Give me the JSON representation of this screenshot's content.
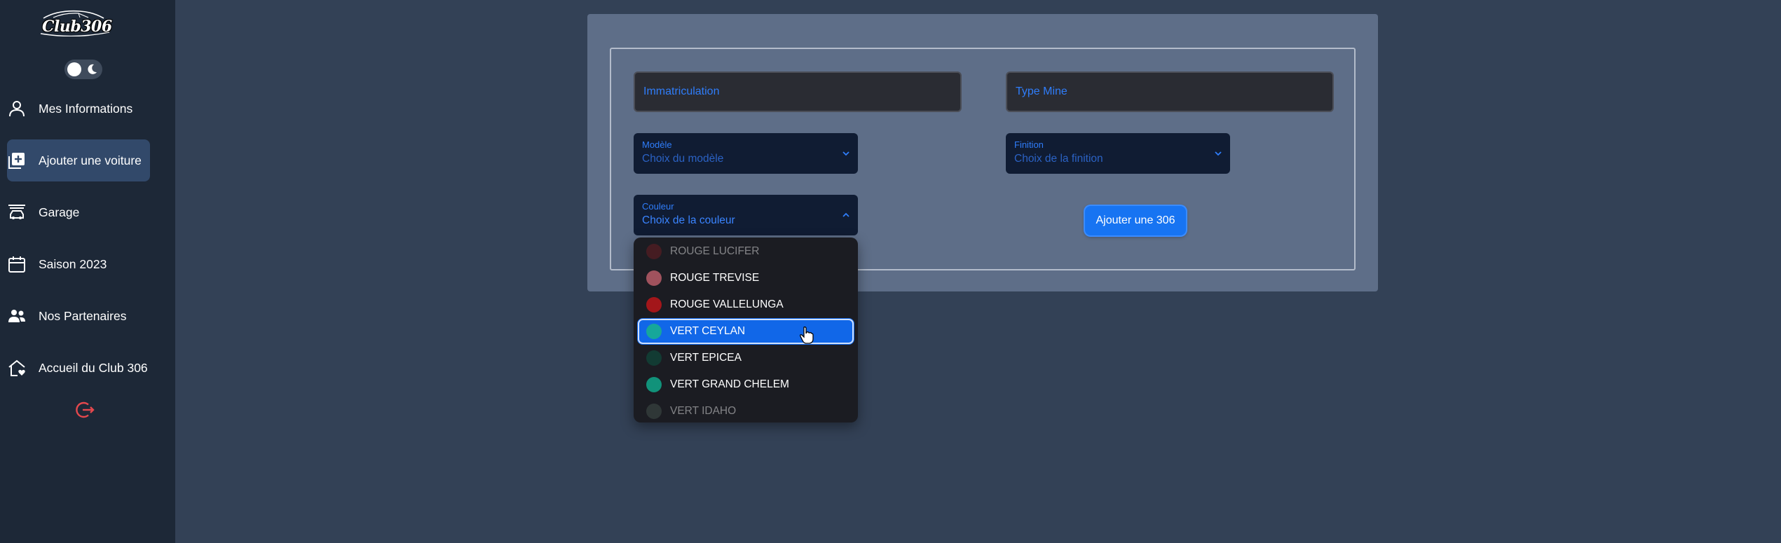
{
  "sidebar": {
    "logo_text": "Club306",
    "items": [
      {
        "label": "Mes Informations",
        "icon": "user-icon"
      },
      {
        "label": "Ajouter une voiture",
        "icon": "add-box-icon",
        "active": true
      },
      {
        "label": "Garage",
        "icon": "car-garage-icon"
      },
      {
        "label": "Saison 2023",
        "icon": "calendar-icon"
      },
      {
        "label": "Nos Partenaires",
        "icon": "people-icon"
      },
      {
        "label": "Accueil du Club 306",
        "icon": "home-heart-icon"
      }
    ],
    "logout_icon": "logout-icon",
    "logout_color": "#e5484d"
  },
  "form": {
    "immatriculation_placeholder": "Immatriculation",
    "type_mine_placeholder": "Type Mine",
    "modele": {
      "label": "Modèle",
      "value": "Choix du modèle"
    },
    "finition": {
      "label": "Finition",
      "value": "Choix de la finition"
    },
    "couleur": {
      "label": "Couleur",
      "value": "Choix de la couleur"
    },
    "submit_label": "Ajouter une 306"
  },
  "colors": {
    "accent": "#1774f2",
    "sidebar_bg": "#1d2837",
    "page_bg": "#334156"
  },
  "couleur_options": [
    {
      "label": "ROUGE LUCIFER",
      "color": "#7a1e24"
    },
    {
      "label": "ROUGE TREVISE",
      "color": "#a0525d"
    },
    {
      "label": "ROUGE VALLELUNGA",
      "color": "#a3161a"
    },
    {
      "label": "VERT CEYLAN",
      "color": "#16a79a",
      "selected": true
    },
    {
      "label": "VERT EPICEA",
      "color": "#123b33"
    },
    {
      "label": "VERT GRAND CHELEM",
      "color": "#11927a"
    },
    {
      "label": "VERT IDAHO",
      "color": "#4a5a52"
    }
  ]
}
